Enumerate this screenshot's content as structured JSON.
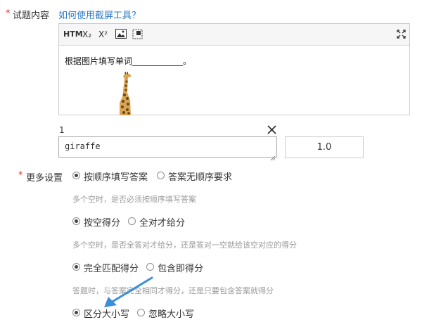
{
  "question": {
    "required_mark": "*",
    "label": "试题内容",
    "help_link": "如何使用截屏工具？"
  },
  "editor": {
    "toolbar": {
      "html_label": "HTM",
      "subscript_label": "X₂",
      "superscript_label": "X²"
    },
    "content_text": "根据图片填写单词____________。"
  },
  "blank": {
    "index": "1",
    "answer": "giraffe",
    "score": "1.0"
  },
  "more_settings": {
    "required_mark": "*",
    "label": "更多设置",
    "groups": [
      {
        "selected": 0,
        "options": [
          "按顺序填写答案",
          "答案无顺序要求"
        ],
        "hint": "多个空时，是否必须按顺序填写答案"
      },
      {
        "selected": 0,
        "options": [
          "按空得分",
          "全对才给分"
        ],
        "hint": "多个空时，是否全答对才给分，还是答对一空就给该空对应的得分"
      },
      {
        "selected": 0,
        "options": [
          "完全匹配得分",
          "包含即得分"
        ],
        "hint": "答题时，与答案完全相同才得分，还是只要包含答案就得分"
      },
      {
        "selected": 0,
        "options": [
          "区分大小写",
          "忽略大小写"
        ],
        "hint": ""
      }
    ]
  },
  "colors": {
    "required": "#e0362a",
    "link": "#2b78c5",
    "arrow": "#3a8fd9",
    "hint": "#999999"
  }
}
